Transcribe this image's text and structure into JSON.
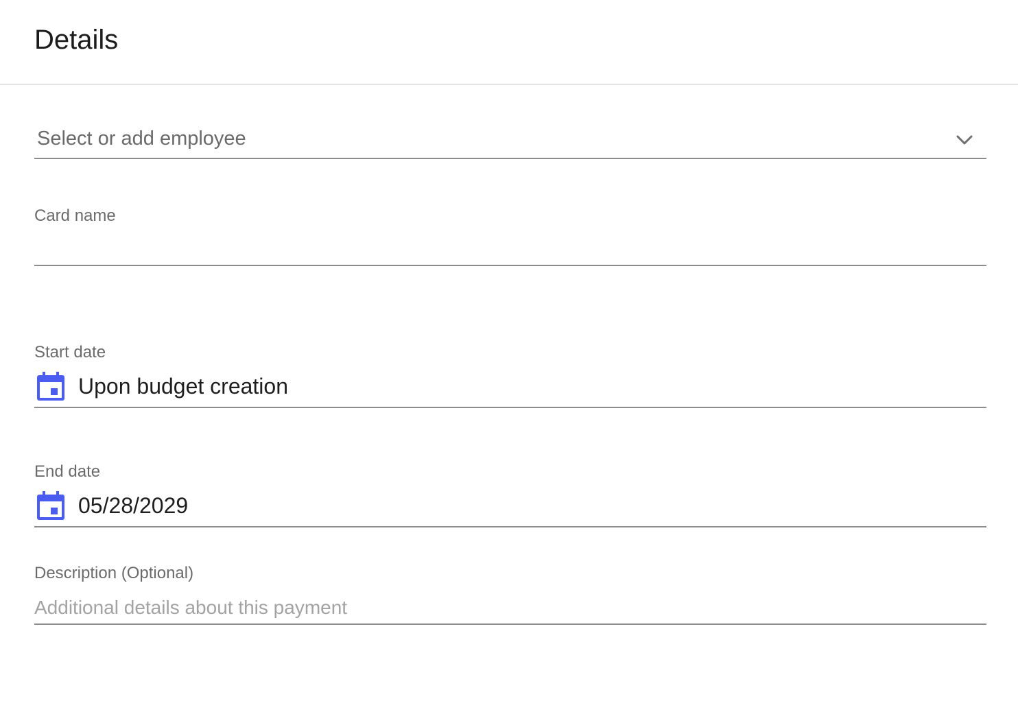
{
  "header": {
    "title": "Details"
  },
  "employee_select": {
    "placeholder": "Select or add employee",
    "icon": "chevron-down-icon"
  },
  "card_name": {
    "label": "Card name",
    "value": ""
  },
  "start_date": {
    "label": "Start date",
    "value": "Upon budget creation",
    "icon": "calendar-icon"
  },
  "end_date": {
    "label": "End date",
    "value": "05/28/2029",
    "icon": "calendar-icon"
  },
  "description": {
    "label": "Description (Optional)",
    "placeholder": "Additional details about this payment"
  },
  "colors": {
    "accent": "#4a5df0",
    "divider": "#e3e3e3",
    "underline": "#8c8c8c"
  }
}
